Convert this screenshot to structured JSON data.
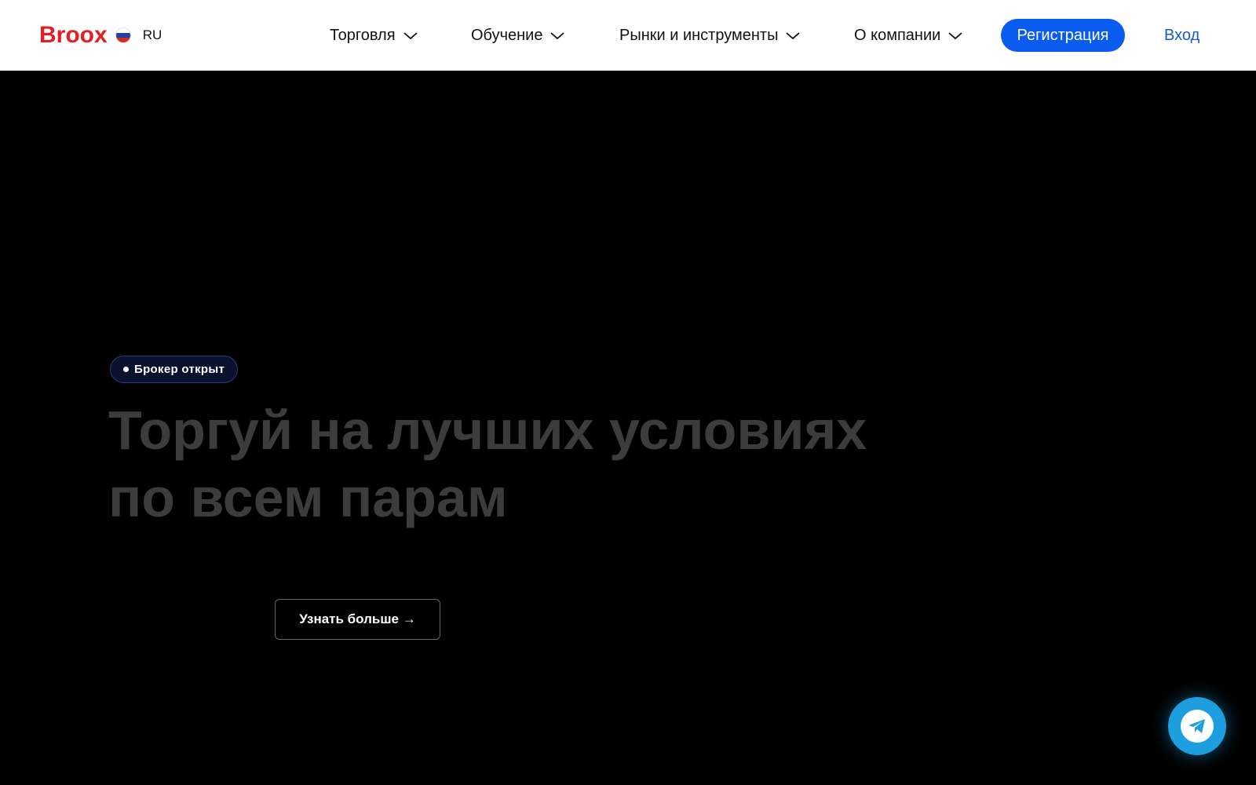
{
  "header": {
    "logo": "Broox",
    "language": "RU",
    "nav": [
      {
        "label": "Торговля"
      },
      {
        "label": "Обучение"
      },
      {
        "label": "Рынки и инструменты"
      },
      {
        "label": "О компании"
      }
    ],
    "register_label": "Регистрация",
    "login_label": "Вход"
  },
  "hero": {
    "badge": "Брокер открыт",
    "headline_line1": "Торгуй на лучших условиях",
    "headline_line2": "по всем парам",
    "cta_label": "Узнать больше →"
  },
  "colors": {
    "brand": "#e31e24",
    "accent": "#0a5bf0",
    "telegram": "#1d9ede"
  },
  "icons": {
    "flag": "russia-flag-icon",
    "chevron": "chevron-down-icon",
    "telegram": "telegram-icon"
  }
}
